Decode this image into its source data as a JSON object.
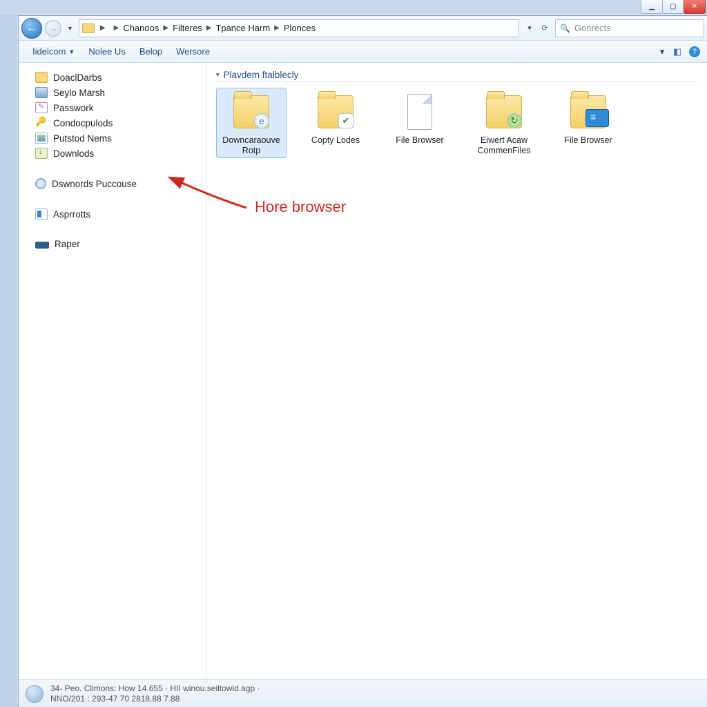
{
  "titlebar": {
    "minimize_glyph": "▁",
    "maximize_glyph": "▢",
    "close_glyph": "✕"
  },
  "nav": {
    "breadcrumb": [
      "Chanoos",
      "Filteres",
      "Tpance Harm",
      "Plonces"
    ],
    "search_placeholder": "Gonrects",
    "refresh_glyph": "⟳",
    "dropdown_glyph": "▾"
  },
  "cmdbar": {
    "items": [
      {
        "label": "Iidelcom",
        "dropdown": true
      },
      {
        "label": "Nolee Us",
        "dropdown": false
      },
      {
        "label": "Belop",
        "dropdown": false
      },
      {
        "label": "Wersore",
        "dropdown": false
      }
    ],
    "right_dropdown_glyph": "▾",
    "tile_glyph": "◧",
    "help_glyph": "?"
  },
  "sidebar": {
    "groups": [
      [
        {
          "label": "DoaclDarbs",
          "icon": "folder"
        },
        {
          "label": "Seylo Marsh",
          "icon": "desktop"
        },
        {
          "label": "Passwork",
          "icon": "doc"
        },
        {
          "label": "Condocpulods",
          "icon": "key"
        },
        {
          "label": "Putstod Nems",
          "icon": "img"
        },
        {
          "label": "Downlods",
          "icon": "dl"
        }
      ],
      [
        {
          "label": "Dswnords Puccouse",
          "icon": "globe"
        }
      ],
      [
        {
          "label": "Asprrotts",
          "icon": "page"
        }
      ],
      [
        {
          "label": "Raper",
          "icon": "drive"
        }
      ]
    ]
  },
  "content": {
    "section_header": "Plavdem ftalblecly",
    "items": [
      {
        "label": "Downcaraouve Rotp",
        "icon": "folder",
        "overlay": "ie",
        "selected": true
      },
      {
        "label": "Copty Lodes",
        "icon": "folder",
        "overlay": "check",
        "selected": false
      },
      {
        "label": "File Browser",
        "icon": "docpage",
        "overlay": "",
        "selected": false
      },
      {
        "label": "Eiwert Acaw CommenFiles",
        "icon": "folder",
        "overlay": "green",
        "selected": false
      },
      {
        "label": "File Browser",
        "icon": "folder",
        "overlay": "screen",
        "selected": false
      }
    ]
  },
  "annotation": {
    "text": "Hore browser"
  },
  "status": {
    "line1": "34- Peo.  Climons: How 14.655 · HII  winou.seiltowid.agp ·",
    "line2": "NNO/201 : 293-47 70 2818.88 7.88"
  }
}
